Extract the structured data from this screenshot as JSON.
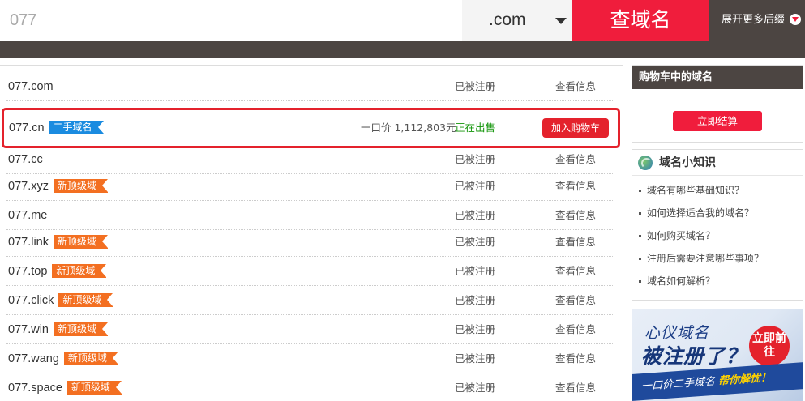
{
  "search": {
    "query": "077",
    "tld": ".com",
    "button_label": "查域名",
    "expand_label": "展开更多后缀"
  },
  "featured": {
    "domain": "077.cn",
    "tag": "二手域名",
    "price": "一口价 1,112,803元",
    "status": "正在出售",
    "button_label": "加入购物车"
  },
  "rows": [
    {
      "domain": "077.com",
      "tag": "",
      "status": "已被注册",
      "info": "查看信息"
    },
    {
      "domain": "077.cc",
      "tag": "",
      "status": "已被注册",
      "info": "查看信息"
    },
    {
      "domain": "077.xyz",
      "tag": "新顶级域",
      "status": "已被注册",
      "info": "查看信息"
    },
    {
      "domain": "077.me",
      "tag": "",
      "status": "已被注册",
      "info": "查看信息"
    },
    {
      "domain": "077.link",
      "tag": "新顶级域",
      "status": "已被注册",
      "info": "查看信息"
    },
    {
      "domain": "077.top",
      "tag": "新顶级域",
      "status": "已被注册",
      "info": "查看信息"
    },
    {
      "domain": "077.click",
      "tag": "新顶级域",
      "status": "已被注册",
      "info": "查看信息"
    },
    {
      "domain": "077.win",
      "tag": "新顶级域",
      "status": "已被注册",
      "info": "查看信息"
    },
    {
      "domain": "077.wang",
      "tag": "新顶级域",
      "status": "已被注册",
      "info": "查看信息"
    },
    {
      "domain": "077.space",
      "tag": "新顶级域",
      "status": "已被注册",
      "info": "查看信息"
    }
  ],
  "cart": {
    "title": "购物车中的域名",
    "checkout_label": "立即结算"
  },
  "knowledge": {
    "title": "域名小知识",
    "items": [
      "域名有哪些基础知识？",
      "如何选择适合我的域名？",
      "如何购买域名？",
      "注册后需要注意哪些事项？",
      "域名如何解析？"
    ]
  },
  "banner": {
    "line1": "心仪域名",
    "line2": "被注册了？",
    "badge": "立即前往",
    "line3_a": "一口价二手域名",
    "line3_b": "帮你解忧！"
  },
  "colors": {
    "accent_red": "#f01d3c",
    "dark_band": "#4c4542",
    "tag_orange": "#f36f21",
    "tag_blue": "#1a8be0",
    "sale_green": "#13950a"
  }
}
